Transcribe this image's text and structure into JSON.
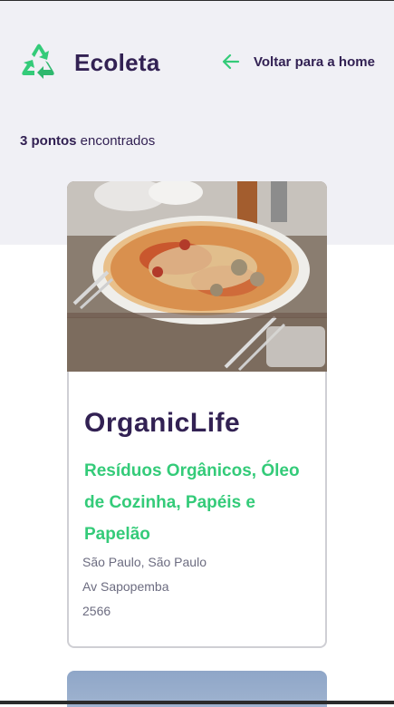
{
  "header": {
    "brand": "Ecoleta",
    "back_label": "Voltar para a home",
    "brand_color": "#322153",
    "accent_color": "#34cb79",
    "logo_icon": "recycle-icon",
    "back_icon": "arrow-left-icon"
  },
  "results": {
    "count": "3 pontos",
    "suffix": " encontrados"
  },
  "points": [
    {
      "name": "OrganicLife",
      "items": "Resíduos Orgânicos, Óleo de Cozinha, Papéis e Papelão",
      "city": "São Paulo, São Paulo",
      "street": "Av Sapopemba",
      "number": "2566"
    }
  ]
}
